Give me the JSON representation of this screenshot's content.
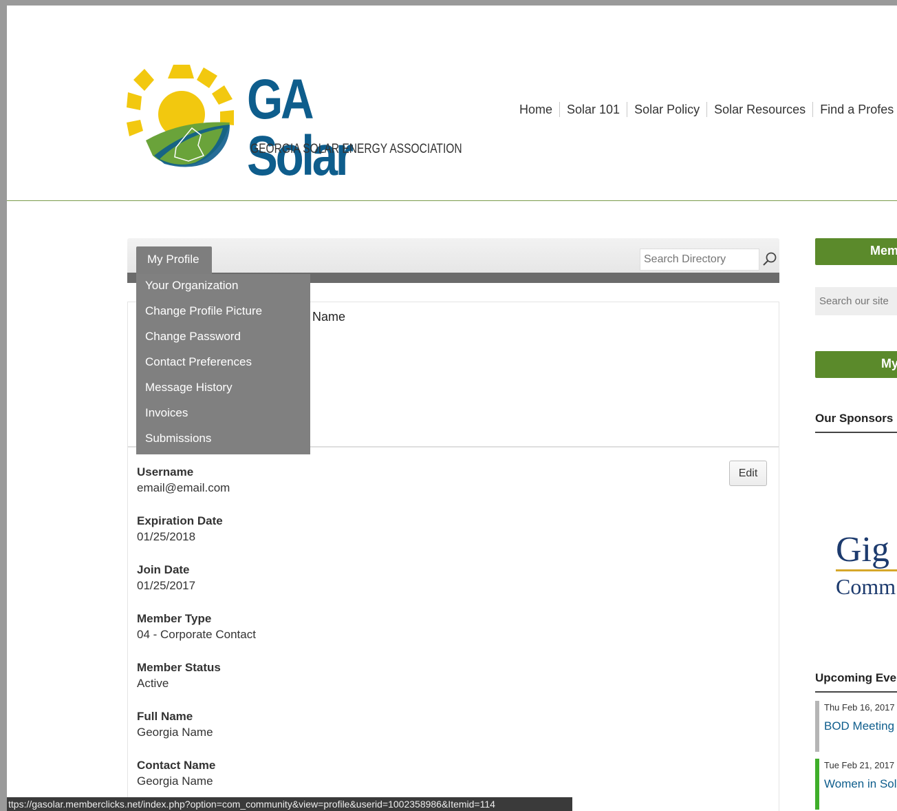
{
  "logo": {
    "title": "GA Solar",
    "subtitle": "GEORGIA SOLAR ENERGY ASSOCIATION"
  },
  "nav": {
    "items": [
      "Home",
      "Solar 101",
      "Solar Policy",
      "Solar Resources",
      "Find a Profes"
    ]
  },
  "profile_tabs": {
    "active_tab": "My Profile",
    "search_placeholder": "Search Directory",
    "dropdown": [
      "Your Organization",
      "Change Profile Picture",
      "Change Password",
      "Contact Preferences",
      "Message History",
      "Invoices",
      "Submissions"
    ]
  },
  "profile": {
    "name_label": "Name",
    "edit_label": "Edit",
    "fields": [
      {
        "label": "Username",
        "value": "email@email.com"
      },
      {
        "label": "Expiration Date",
        "value": "01/25/2018"
      },
      {
        "label": "Join Date",
        "value": "01/25/2017"
      },
      {
        "label": "Member Type",
        "value": "04 - Corporate Contact"
      },
      {
        "label": "Member Status",
        "value": "Active"
      },
      {
        "label": "Full Name",
        "value": "Georgia Name"
      },
      {
        "label": "Contact Name",
        "value": "Georgia Name"
      }
    ]
  },
  "sidebar": {
    "member_button": "Mem",
    "search_placeholder": "Search our site",
    "my_button": "My",
    "sponsors_heading": "Our Sponsors",
    "sponsor_text_1": "Gig",
    "sponsor_text_2": "Comm",
    "events_heading": "Upcoming Eve",
    "events": [
      {
        "date": "Thu Feb 16, 2017",
        "title": "BOD Meeting",
        "color": "#b5b5b5"
      },
      {
        "date": "Tue Feb 21, 2017",
        "title": "Women in Sol",
        "color": "#3fae2a"
      }
    ]
  },
  "status_bar": "ttps://gasolar.memberclicks.net/index.php?option=com_community&view=profile&userid=1002358986&Itemid=114",
  "colors": {
    "brand_blue": "#0e5d8c",
    "brand_green": "#5b8a2b",
    "sun_yellow": "#f2c80f"
  }
}
